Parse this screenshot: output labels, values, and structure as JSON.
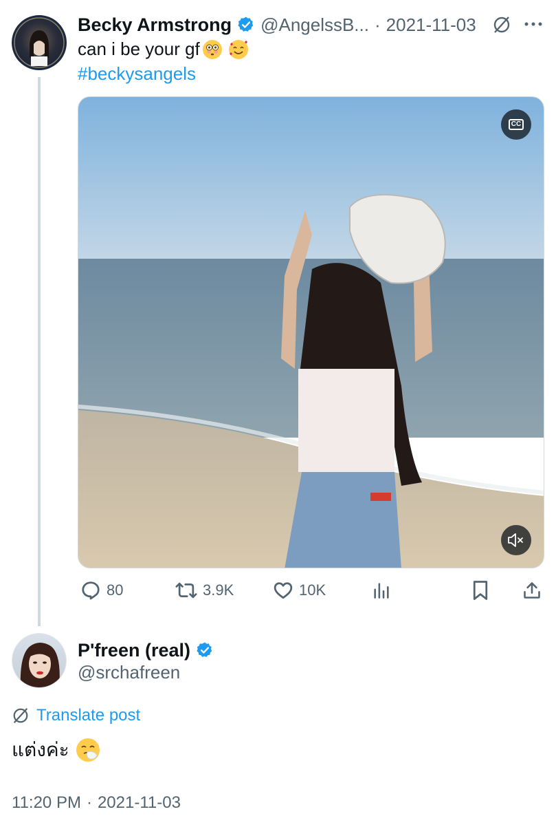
{
  "original_tweet": {
    "author_name": "Becky Armstrong",
    "handle": "@AngelssB...",
    "separator": "·",
    "date": "2021-11-03",
    "text": "can i be your gf",
    "emojis": [
      "flushed-face",
      "smiling-face-with-hearts"
    ],
    "hashtag": "#beckysangels",
    "media": {
      "type": "video",
      "cc_label": "CC",
      "muted": true
    },
    "actions": {
      "replies": "80",
      "reposts": "3.9K",
      "likes": "10K"
    }
  },
  "reply_tweet": {
    "author_name": "P'freen (real)",
    "handle": "@srchafreen",
    "translate_label": "Translate post",
    "text": "แต่งค่ะ",
    "emoji": "sneezing-face",
    "time": "11:20 PM",
    "separator": "·",
    "date": "2021-11-03"
  },
  "colors": {
    "accent": "#1d9bf0",
    "muted": "#536471",
    "text": "#0f1419"
  }
}
